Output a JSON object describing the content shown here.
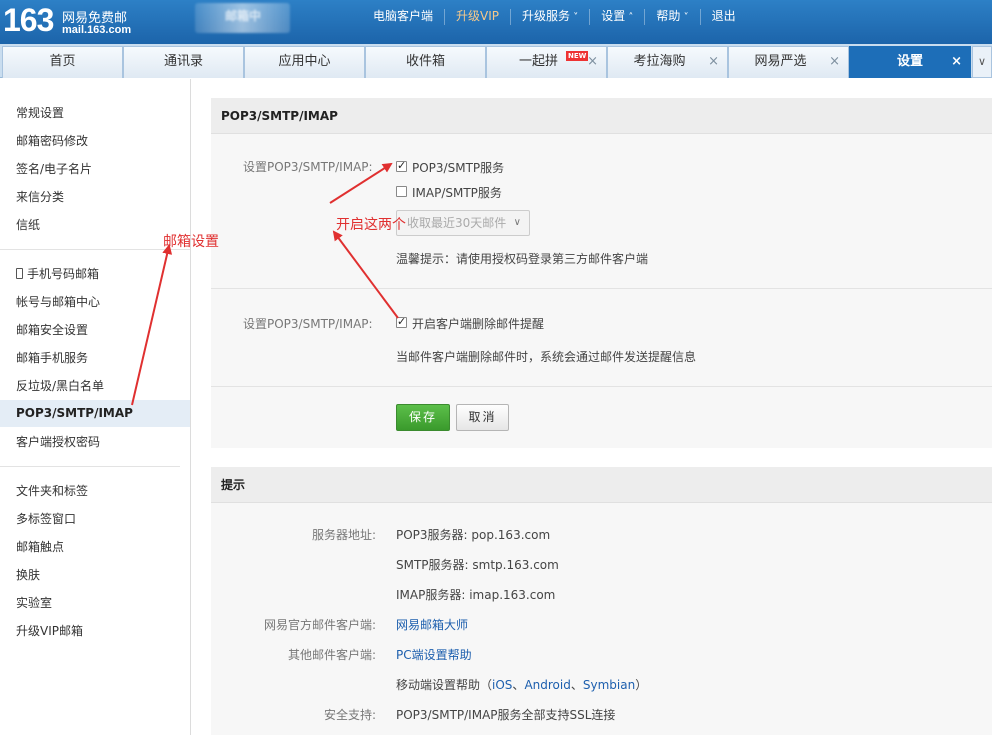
{
  "header": {
    "logo_number": "163",
    "logo_title": "网易免费邮",
    "logo_domain": "mail.163.com",
    "user_name": "邮箱中",
    "nav": [
      {
        "label": "电脑客户端",
        "kind": "plain"
      },
      {
        "label": "升级VIP",
        "kind": "vip"
      },
      {
        "label": "升级服务",
        "kind": "down"
      },
      {
        "label": "设置",
        "kind": "up"
      },
      {
        "label": "帮助",
        "kind": "down"
      },
      {
        "label": "退出",
        "kind": "plain"
      }
    ]
  },
  "tabs": {
    "items": [
      "首页",
      "通讯录",
      "应用中心",
      "收件箱",
      "一起拼",
      "考拉海购",
      "网易严选",
      "设置"
    ],
    "new_badge": "NEW",
    "close_glyph": "×",
    "more_glyph": "∨"
  },
  "sidebar": {
    "items": [
      "常规设置",
      "邮箱密码修改",
      "签名/电子名片",
      "来信分类",
      "信纸",
      "手机号码邮箱",
      "帐号与邮箱中心",
      "邮箱安全设置",
      "邮箱手机服务",
      "反垃圾/黑白名单",
      "POP3/SMTP/IMAP",
      "客户端授权密码",
      "文件夹和标签",
      "多标签窗口",
      "邮箱触点",
      "换肤",
      "实验室",
      "升级VIP邮箱"
    ]
  },
  "settings_panel": {
    "title": "POP3/SMTP/IMAP",
    "row1_label": "设置POP3/SMTP/IMAP:",
    "pop3_option": "POP3/SMTP服务",
    "pop3_checked": true,
    "imap_option": "IMAP/SMTP服务",
    "imap_checked": false,
    "fetch_select": "收取最近30天邮件",
    "tip": "温馨提示：请使用授权码登录第三方邮件客户端",
    "row2_label": "设置POP3/SMTP/IMAP:",
    "delete_notify_option": "开启客户端删除邮件提醒",
    "delete_notify_checked": true,
    "delete_notify_desc": "当邮件客户端删除邮件时，系统会通过邮件发送提醒信息",
    "save_label": "保存",
    "cancel_label": "取消"
  },
  "tips_panel": {
    "title": "提示",
    "server_label": "服务器地址:",
    "pop3_server": "POP3服务器: pop.163.com",
    "smtp_server": "SMTP服务器: smtp.163.com",
    "imap_server": "IMAP服务器: imap.163.com",
    "official_client_label": "网易官方邮件客户端:",
    "official_client_link": "网易邮箱大师",
    "other_client_label": "其他邮件客户端:",
    "other_client_link": "PC端设置帮助",
    "mobile_help_prefix": "移动端设置帮助（",
    "mobile_ios": "iOS",
    "mobile_sep1": "、",
    "mobile_android": "Android",
    "mobile_sep2": "、",
    "mobile_symbian": "Symbian",
    "mobile_help_suffix": "）",
    "security_label": "安全支持:",
    "security_value": "POP3/SMTP/IMAP服务全部支持SSL连接"
  },
  "annotations": {
    "mailbox_settings": "邮箱设置",
    "enable_both": "开启这两个",
    "color": "#e03030"
  }
}
